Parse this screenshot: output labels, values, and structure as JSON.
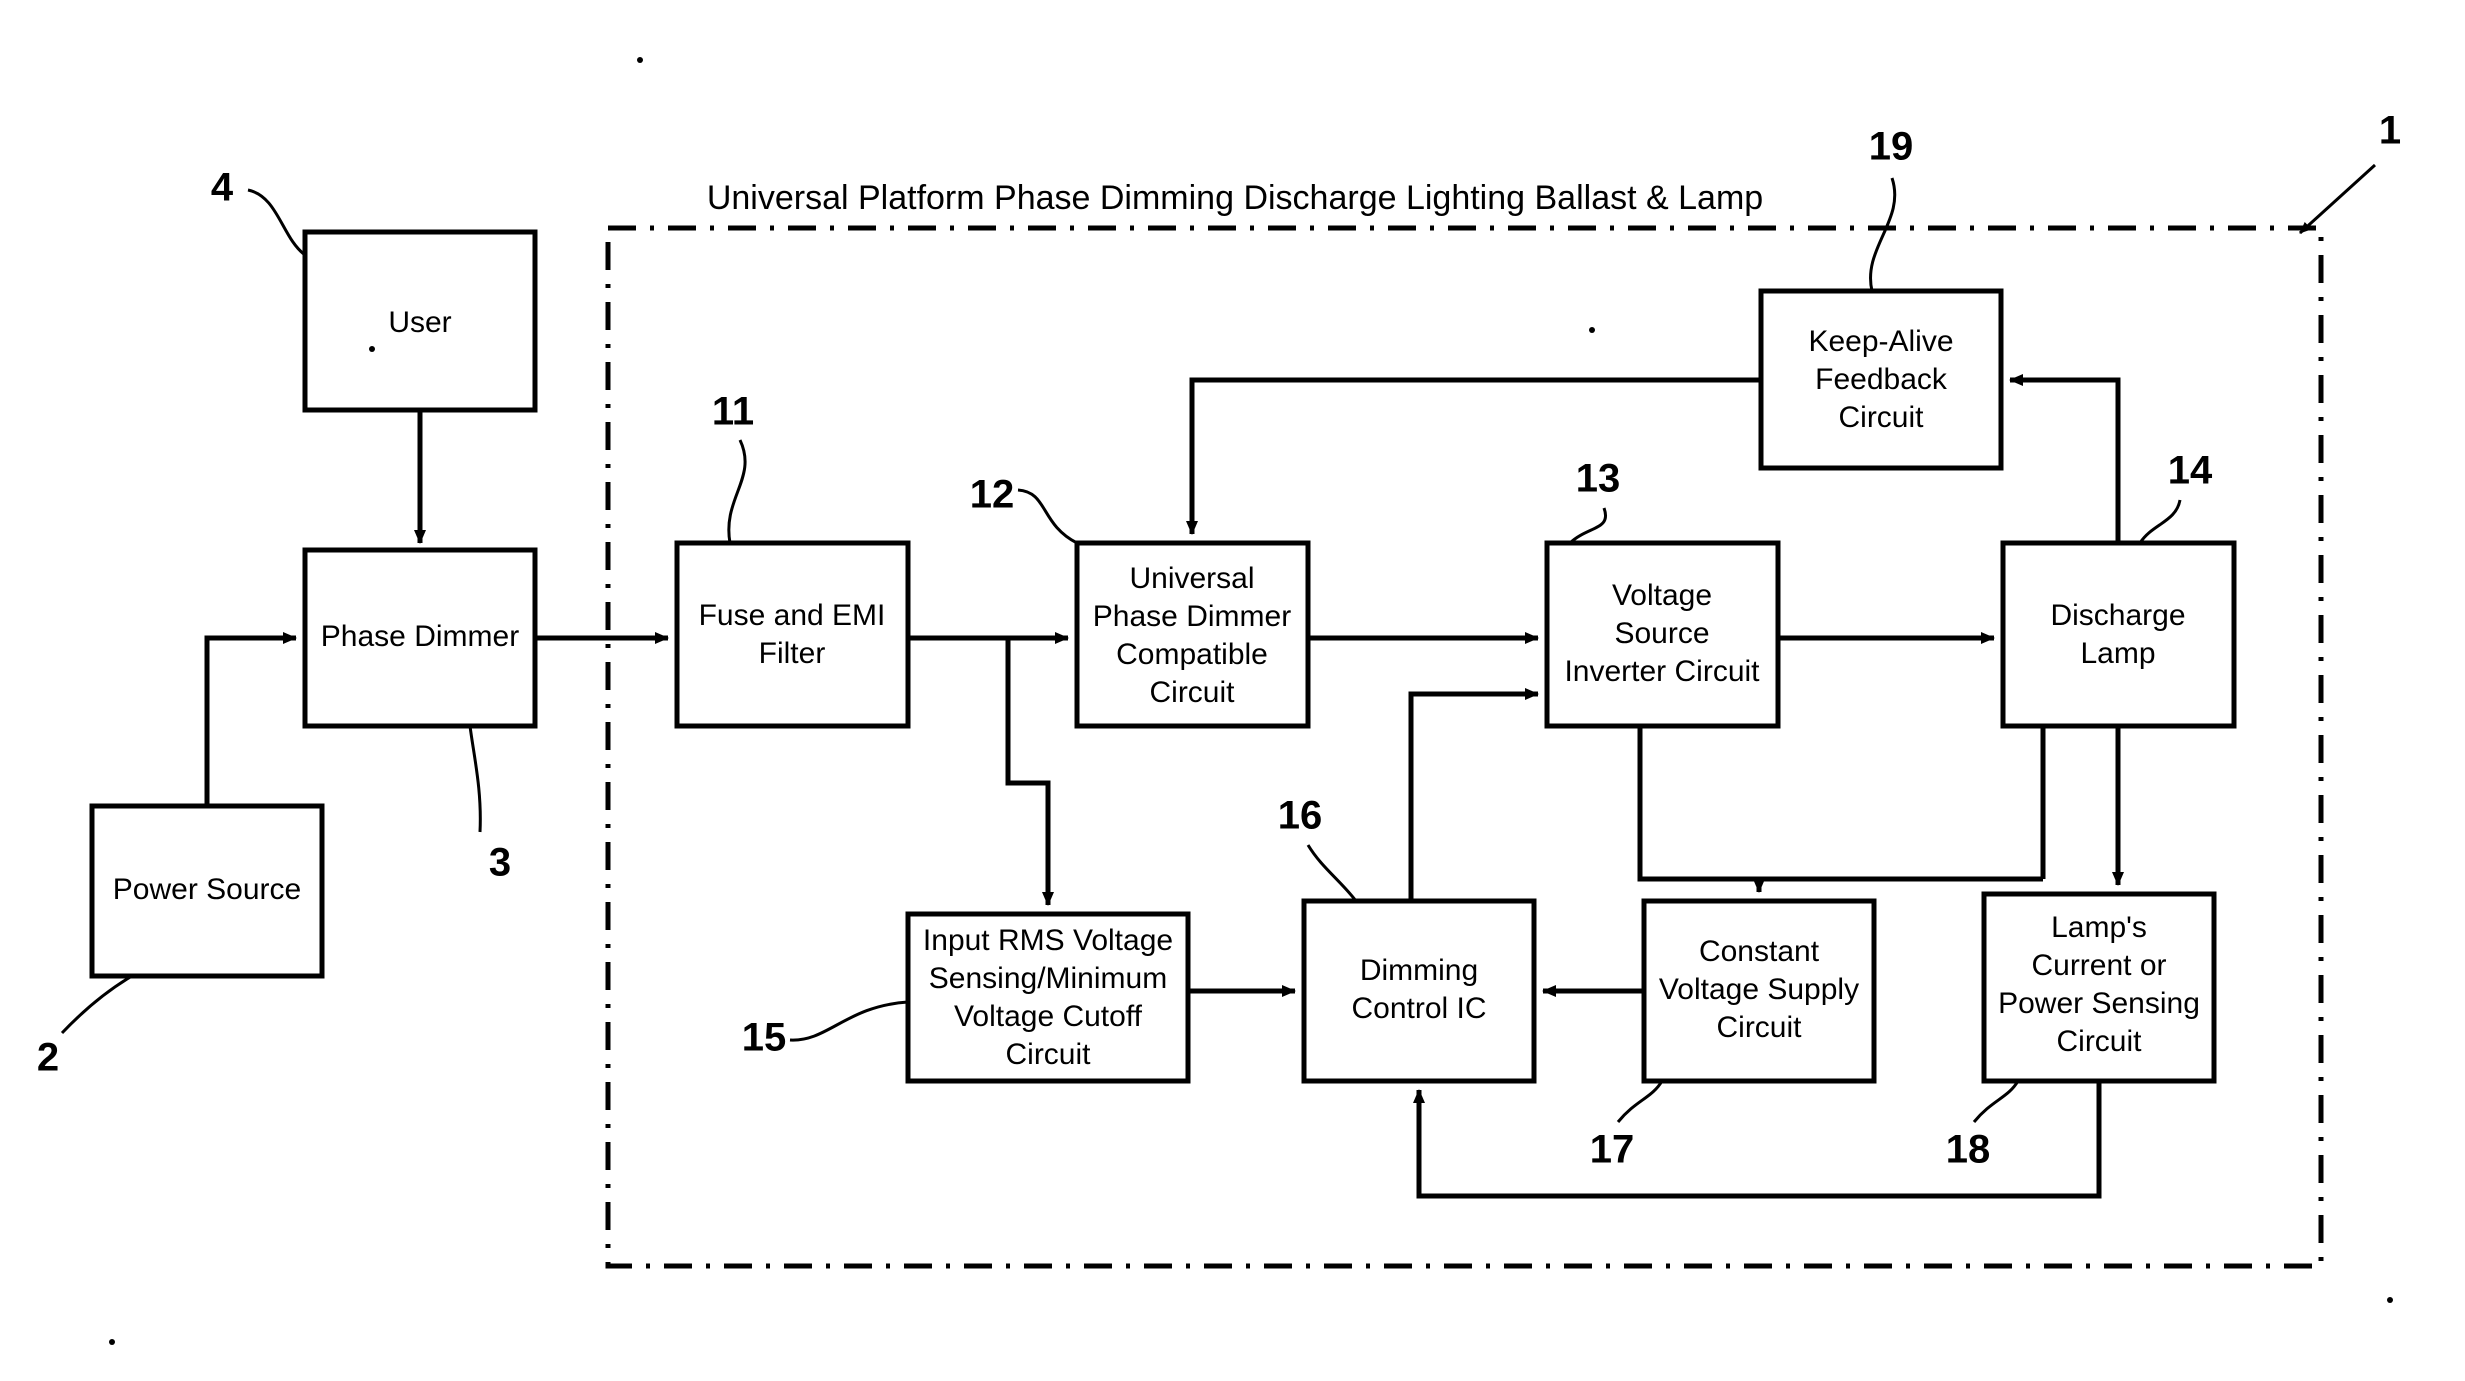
{
  "figure": {
    "title": "Universal Platform Phase Dimming Discharge Lighting Ballast & Lamp",
    "boundary_ref": "1"
  },
  "blocks": [
    {
      "id": "user",
      "ref": "4",
      "lines": [
        "User"
      ]
    },
    {
      "id": "phase_dimmer",
      "ref": "3",
      "lines": [
        "Phase Dimmer"
      ]
    },
    {
      "id": "power_source",
      "ref": "2",
      "lines": [
        "Power Source"
      ]
    },
    {
      "id": "fuse_emi",
      "ref": "11",
      "lines": [
        "Fuse and EMI",
        "Filter"
      ]
    },
    {
      "id": "upd_compat",
      "ref": "12",
      "lines": [
        "Universal",
        "Phase Dimmer",
        "Compatible",
        "Circuit"
      ]
    },
    {
      "id": "vsi",
      "ref": "13",
      "lines": [
        "Voltage",
        "Source",
        "Inverter Circuit"
      ]
    },
    {
      "id": "discharge_lamp",
      "ref": "14",
      "lines": [
        "Discharge",
        "Lamp"
      ]
    },
    {
      "id": "keep_alive",
      "ref": "19",
      "lines": [
        "Keep-Alive",
        "Feedback",
        "Circuit"
      ]
    },
    {
      "id": "input_rms",
      "ref": "15",
      "lines": [
        "Input RMS Voltage",
        "Sensing/Minimum",
        "Voltage Cutoff",
        "Circuit"
      ]
    },
    {
      "id": "dimming_ic",
      "ref": "16",
      "lines": [
        "Dimming",
        "Control IC"
      ]
    },
    {
      "id": "cvs",
      "ref": "17",
      "lines": [
        "Constant",
        "Voltage Supply",
        "Circuit"
      ]
    },
    {
      "id": "lamp_sense",
      "ref": "18",
      "lines": [
        "Lamp's",
        "Current or",
        "Power Sensing",
        "Circuit"
      ]
    }
  ],
  "colors": {
    "ink": "#000000",
    "paper": "#ffffff"
  }
}
